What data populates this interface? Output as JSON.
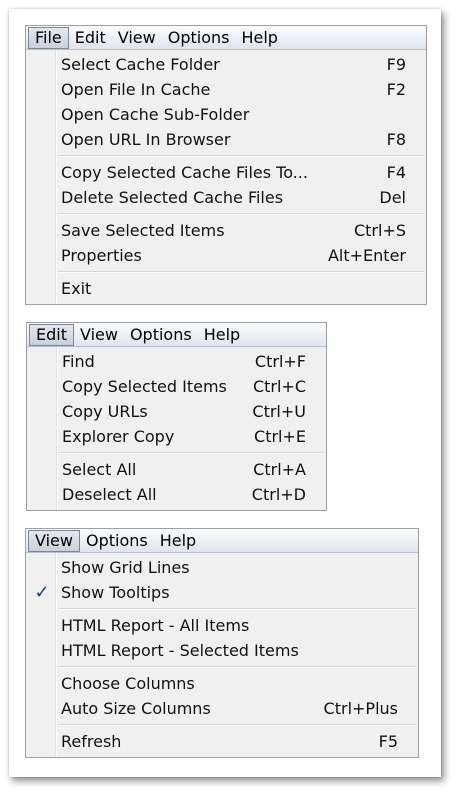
{
  "file_menu": {
    "bar": [
      "File",
      "Edit",
      "View",
      "Options",
      "Help"
    ],
    "active": 0,
    "items": [
      {
        "label": "Select Cache Folder",
        "key": "F9"
      },
      {
        "label": "Open File In Cache",
        "key": "F2"
      },
      {
        "label": "Open Cache Sub-Folder",
        "key": ""
      },
      {
        "label": "Open URL In Browser",
        "key": "F8"
      },
      {
        "sep": true
      },
      {
        "label": "Copy Selected Cache Files To...",
        "key": "F4"
      },
      {
        "label": "Delete Selected Cache Files",
        "key": "Del"
      },
      {
        "sep": true
      },
      {
        "label": "Save Selected Items",
        "key": "Ctrl+S"
      },
      {
        "label": "Properties",
        "key": "Alt+Enter"
      },
      {
        "sep": true
      },
      {
        "label": "Exit",
        "key": ""
      }
    ]
  },
  "edit_menu": {
    "bar": [
      "Edit",
      "View",
      "Options",
      "Help"
    ],
    "active": 0,
    "items": [
      {
        "label": "Find",
        "key": "Ctrl+F"
      },
      {
        "label": "Copy Selected Items",
        "key": "Ctrl+C"
      },
      {
        "label": "Copy URLs",
        "key": "Ctrl+U"
      },
      {
        "label": "Explorer Copy",
        "key": "Ctrl+E"
      },
      {
        "sep": true
      },
      {
        "label": "Select All",
        "key": "Ctrl+A"
      },
      {
        "label": "Deselect All",
        "key": "Ctrl+D"
      }
    ]
  },
  "view_menu": {
    "bar": [
      "View",
      "Options",
      "Help"
    ],
    "active": 0,
    "items": [
      {
        "label": "Show Grid Lines",
        "key": "",
        "checked": false
      },
      {
        "label": "Show Tooltips",
        "key": "",
        "checked": true
      },
      {
        "sep": true
      },
      {
        "label": "HTML Report - All Items",
        "key": ""
      },
      {
        "label": "HTML Report - Selected Items",
        "key": ""
      },
      {
        "sep": true
      },
      {
        "label": "Choose Columns",
        "key": ""
      },
      {
        "label": "Auto Size Columns",
        "key": "Ctrl+Plus"
      },
      {
        "sep": true
      },
      {
        "label": "Refresh",
        "key": "F5"
      }
    ],
    "check_glyph": "✓"
  },
  "colors": {
    "accent": "#1a3f8a",
    "menu_bg": "#f0f0f0",
    "bar_top": "#fafbfd",
    "bar_bottom": "#dfe5ee"
  }
}
